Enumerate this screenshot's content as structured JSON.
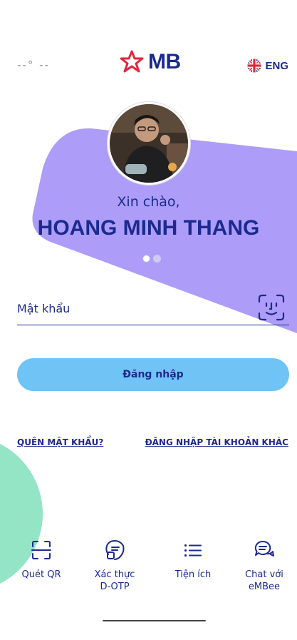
{
  "header": {
    "weather_text": "--°  --",
    "logo_text": "MB",
    "lang_label": "ENG"
  },
  "profile": {
    "greeting": "Xin chào,",
    "name": "HOANG MINH THANG",
    "carousel_active_index": 0,
    "carousel_total": 2
  },
  "login": {
    "password_placeholder": "Mật khẩu",
    "password_value": "",
    "submit_label": "Đăng nhập",
    "forgot_label": "QUÊN MẬT KHẨU?",
    "other_account_label": "ĐĂNG NHẬP TÀI KHOẢN KHÁC"
  },
  "quick_actions": [
    {
      "label": "Quét QR",
      "icon": "qr-scan-icon"
    },
    {
      "label": "Xác thực\nD-OTP",
      "icon": "otp-shield-icon"
    },
    {
      "label": "Tiện ích",
      "icon": "list-icon"
    },
    {
      "label": "Chat với\neMBee",
      "icon": "chat-bubbles-icon"
    }
  ],
  "colors": {
    "brand_navy": "#1b2a8f",
    "brand_red": "#e3263b",
    "accent_purple": "#ad9df8",
    "button_blue": "#6fc4f5",
    "accent_mint": "#94e4c6"
  }
}
